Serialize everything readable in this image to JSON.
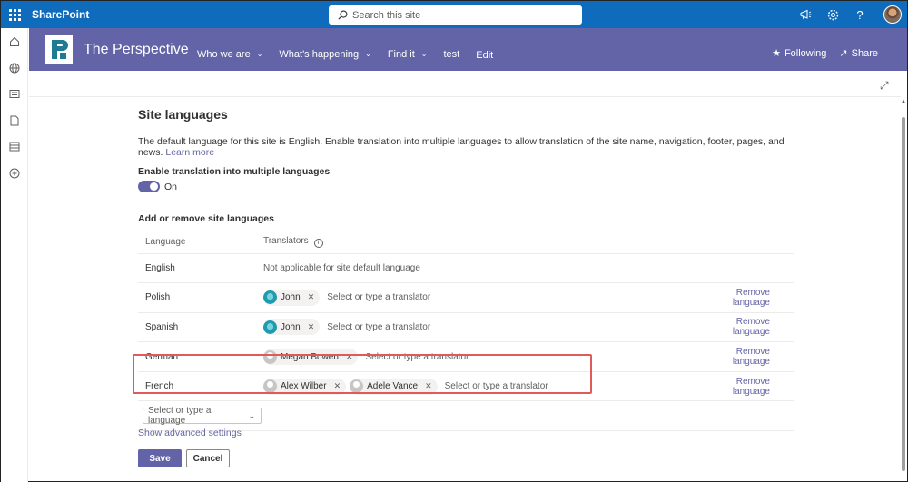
{
  "suite": {
    "app_name": "SharePoint",
    "search_placeholder": "Search this site",
    "icons": [
      "megaphone-icon",
      "settings-icon",
      "help-icon",
      "user-avatar"
    ]
  },
  "rail": {
    "icons": [
      "home-icon",
      "globe-icon",
      "news-icon",
      "document-icon",
      "list-icon",
      "add-icon"
    ]
  },
  "site": {
    "title": "The Perspective",
    "nav": [
      {
        "label": "Who we are",
        "dropdown": true
      },
      {
        "label": "What's happening",
        "dropdown": true
      },
      {
        "label": "Find it",
        "dropdown": true
      },
      {
        "label": "test",
        "dropdown": false
      },
      {
        "label": "Edit",
        "dropdown": false
      }
    ],
    "following_label": "Following",
    "share_label": "Share",
    "header_color": "#6264a7"
  },
  "page": {
    "heading": "Site languages",
    "description": "The default language for this site is English. Enable translation into multiple languages to allow translation of the site name, navigation, footer, pages, and news.",
    "learn_more": "Learn more",
    "toggle_label": "Enable translation into multiple languages",
    "toggle_state": "On",
    "section_label": "Add or remove site languages",
    "table": {
      "col_language": "Language",
      "col_translators": "Translators",
      "default_note": "Not applicable for site default language",
      "translator_placeholder": "Select or type a translator",
      "remove_label": "Remove language",
      "rows": [
        {
          "language": "English",
          "translators": [],
          "default": true
        },
        {
          "language": "Polish",
          "translators": [
            {
              "name": "John",
              "avatar": "teal"
            }
          ]
        },
        {
          "language": "Spanish",
          "translators": [
            {
              "name": "John",
              "avatar": "teal"
            }
          ]
        },
        {
          "language": "German",
          "translators": [
            {
              "name": "Megan Bowen",
              "avatar": "gray"
            }
          ]
        },
        {
          "language": "French",
          "translators": [
            {
              "name": "Alex Wilber",
              "avatar": "gray"
            },
            {
              "name": "Adele Vance",
              "avatar": "gray"
            }
          ]
        }
      ]
    },
    "language_picker_placeholder": "Select or type a language",
    "advanced_link": "Show advanced settings",
    "save_label": "Save",
    "cancel_label": "Cancel",
    "accent_color": "#6264a7",
    "highlight_color": "#e05a5a"
  }
}
